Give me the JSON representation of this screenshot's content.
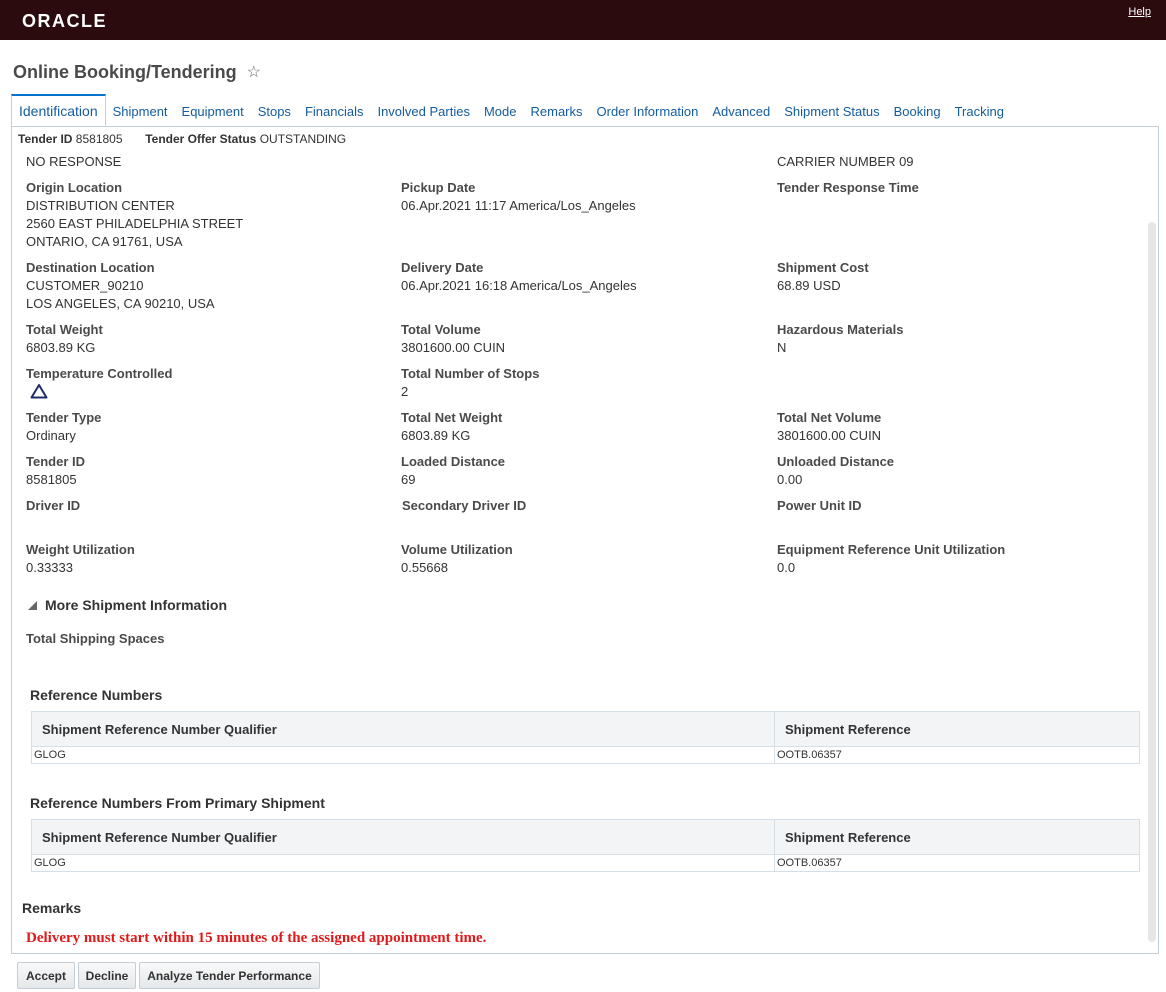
{
  "header": {
    "logo": "ORACLE",
    "help": "Help"
  },
  "page": {
    "title": "Online Booking/Tendering"
  },
  "tabs": [
    "Identification",
    "Shipment",
    "Equipment",
    "Stops",
    "Financials",
    "Involved Parties",
    "Mode",
    "Remarks",
    "Order Information",
    "Advanced",
    "Shipment Status",
    "Booking",
    "Tracking"
  ],
  "tender_summary": {
    "tender_id_label": "Tender ID",
    "tender_id": "8581805",
    "status_label": "Tender Offer Status",
    "status": "OUTSTANDING"
  },
  "top_values": {
    "col1": "NO RESPONSE",
    "col3": "CARRIER NUMBER 09"
  },
  "fields": {
    "origin_location": {
      "label": "Origin Location",
      "lines": [
        "DISTRIBUTION CENTER",
        "2560 EAST PHILADELPHIA STREET",
        "ONTARIO, CA 91761, USA"
      ]
    },
    "pickup_date": {
      "label": "Pickup Date",
      "value": "06.Apr.2021 11:17 America/Los_Angeles"
    },
    "tender_response_time": {
      "label": "Tender Response Time",
      "value": ""
    },
    "destination_location": {
      "label": "Destination Location",
      "lines": [
        "CUSTOMER_90210",
        "LOS ANGELES, CA 90210, USA"
      ]
    },
    "delivery_date": {
      "label": "Delivery Date",
      "value": "06.Apr.2021 16:18 America/Los_Angeles"
    },
    "shipment_cost": {
      "label": "Shipment Cost",
      "value": "68.89 USD"
    },
    "total_weight": {
      "label": "Total Weight",
      "value": "6803.89 KG"
    },
    "total_volume": {
      "label": "Total Volume",
      "value": "3801600.00 CUIN"
    },
    "hazardous_materials": {
      "label": "Hazardous Materials",
      "value": "N"
    },
    "temperature_controlled": {
      "label": "Temperature Controlled",
      "icon": "warning-triangle-icon"
    },
    "total_number_of_stops": {
      "label": "Total Number of Stops",
      "value": "2"
    },
    "tender_type": {
      "label": "Tender Type",
      "value": "Ordinary"
    },
    "total_net_weight": {
      "label": "Total Net Weight",
      "value": "6803.89 KG"
    },
    "total_net_volume": {
      "label": "Total Net Volume",
      "value": "3801600.00 CUIN"
    },
    "tender_id": {
      "label": "Tender ID",
      "value": "8581805"
    },
    "loaded_distance": {
      "label": "Loaded Distance",
      "value": "69"
    },
    "unloaded_distance": {
      "label": "Unloaded Distance",
      "value": "0.00"
    },
    "driver_id": {
      "label": "Driver ID",
      "value": ""
    },
    "secondary_driver_id": {
      "label": "Secondary Driver ID",
      "value": ""
    },
    "power_unit_id": {
      "label": "Power Unit ID",
      "value": ""
    },
    "weight_utilization": {
      "label": "Weight Utilization",
      "value": "0.33333"
    },
    "volume_utilization": {
      "label": "Volume Utilization",
      "value": "0.55668"
    },
    "equipment_ref_unit_utilization": {
      "label": "Equipment Reference Unit Utilization",
      "value": "0.0"
    }
  },
  "more_info": {
    "label": "More Shipment Information",
    "total_shipping_spaces_label": "Total Shipping Spaces"
  },
  "reference_numbers": {
    "title": "Reference Numbers",
    "headers": [
      "Shipment Reference Number Qualifier",
      "Shipment Reference"
    ],
    "rows": [
      [
        "GLOG",
        "OOTB.06357"
      ]
    ]
  },
  "reference_numbers_primary": {
    "title": "Reference Numbers From Primary Shipment",
    "headers": [
      "Shipment Reference Number Qualifier",
      "Shipment Reference"
    ],
    "rows": [
      [
        "GLOG",
        "OOTB.06357"
      ]
    ]
  },
  "remarks": {
    "title": "Remarks",
    "text": "Delivery must start within 15 minutes of the assigned appointment time.",
    "color": "#e01a1a"
  },
  "buttons": {
    "accept": "Accept",
    "decline": "Decline",
    "analyze": "Analyze Tender Performance"
  },
  "colors": {
    "header_bg": "#2b0b0e",
    "link": "#145c9e",
    "tab_active_border": "#0572ce"
  }
}
